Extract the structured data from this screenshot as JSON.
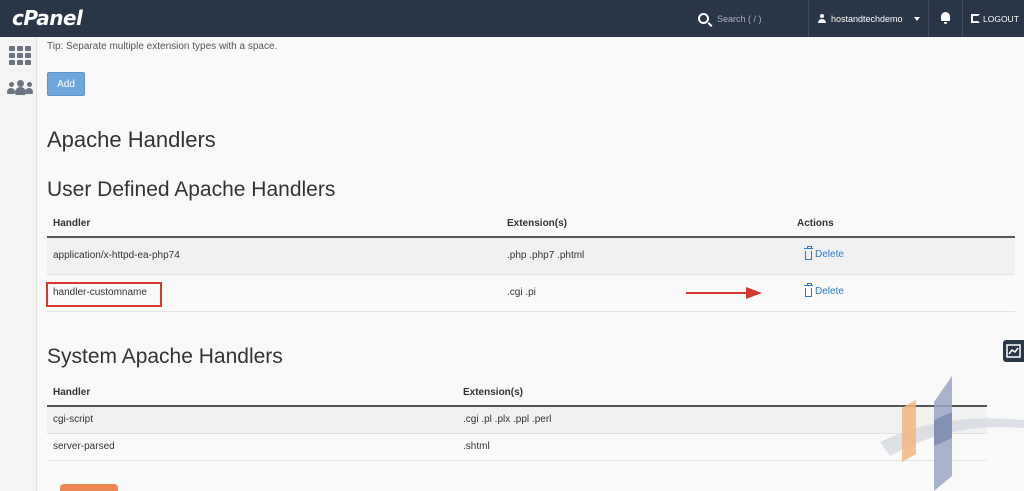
{
  "header": {
    "logo": "cPanel",
    "search_placeholder": "Search ( / )",
    "username": "hostandtechdemo",
    "logout_label": "LOGOUT"
  },
  "sidebar": {
    "icons": [
      "apps-grid-icon",
      "users-icon"
    ]
  },
  "tip": "Tip: Separate multiple extension types with a space.",
  "add_button": "Add",
  "apache_title": "Apache Handlers",
  "user_section": {
    "title": "User Defined Apache Handlers",
    "columns": [
      "Handler",
      "Extension(s)",
      "Actions"
    ],
    "rows": [
      {
        "handler": "application/x-httpd-ea-php74",
        "extensions": ".php .php7 .phtml",
        "action": "Delete"
      },
      {
        "handler": "handler-customname",
        "extensions": ".cgi .pi",
        "action": "Delete"
      }
    ]
  },
  "system_section": {
    "title": "System Apache Handlers",
    "columns": [
      "Handler",
      "Extension(s)"
    ],
    "rows": [
      {
        "handler": "cgi-script",
        "extensions": ".cgi .pl .plx .ppl .perl"
      },
      {
        "handler": "server-parsed",
        "extensions": ".shtml"
      }
    ]
  },
  "colors": {
    "header_bg": "#283648",
    "link": "#2c7ac6",
    "button": "#6fa7dc",
    "highlight": "#d63a2f"
  }
}
